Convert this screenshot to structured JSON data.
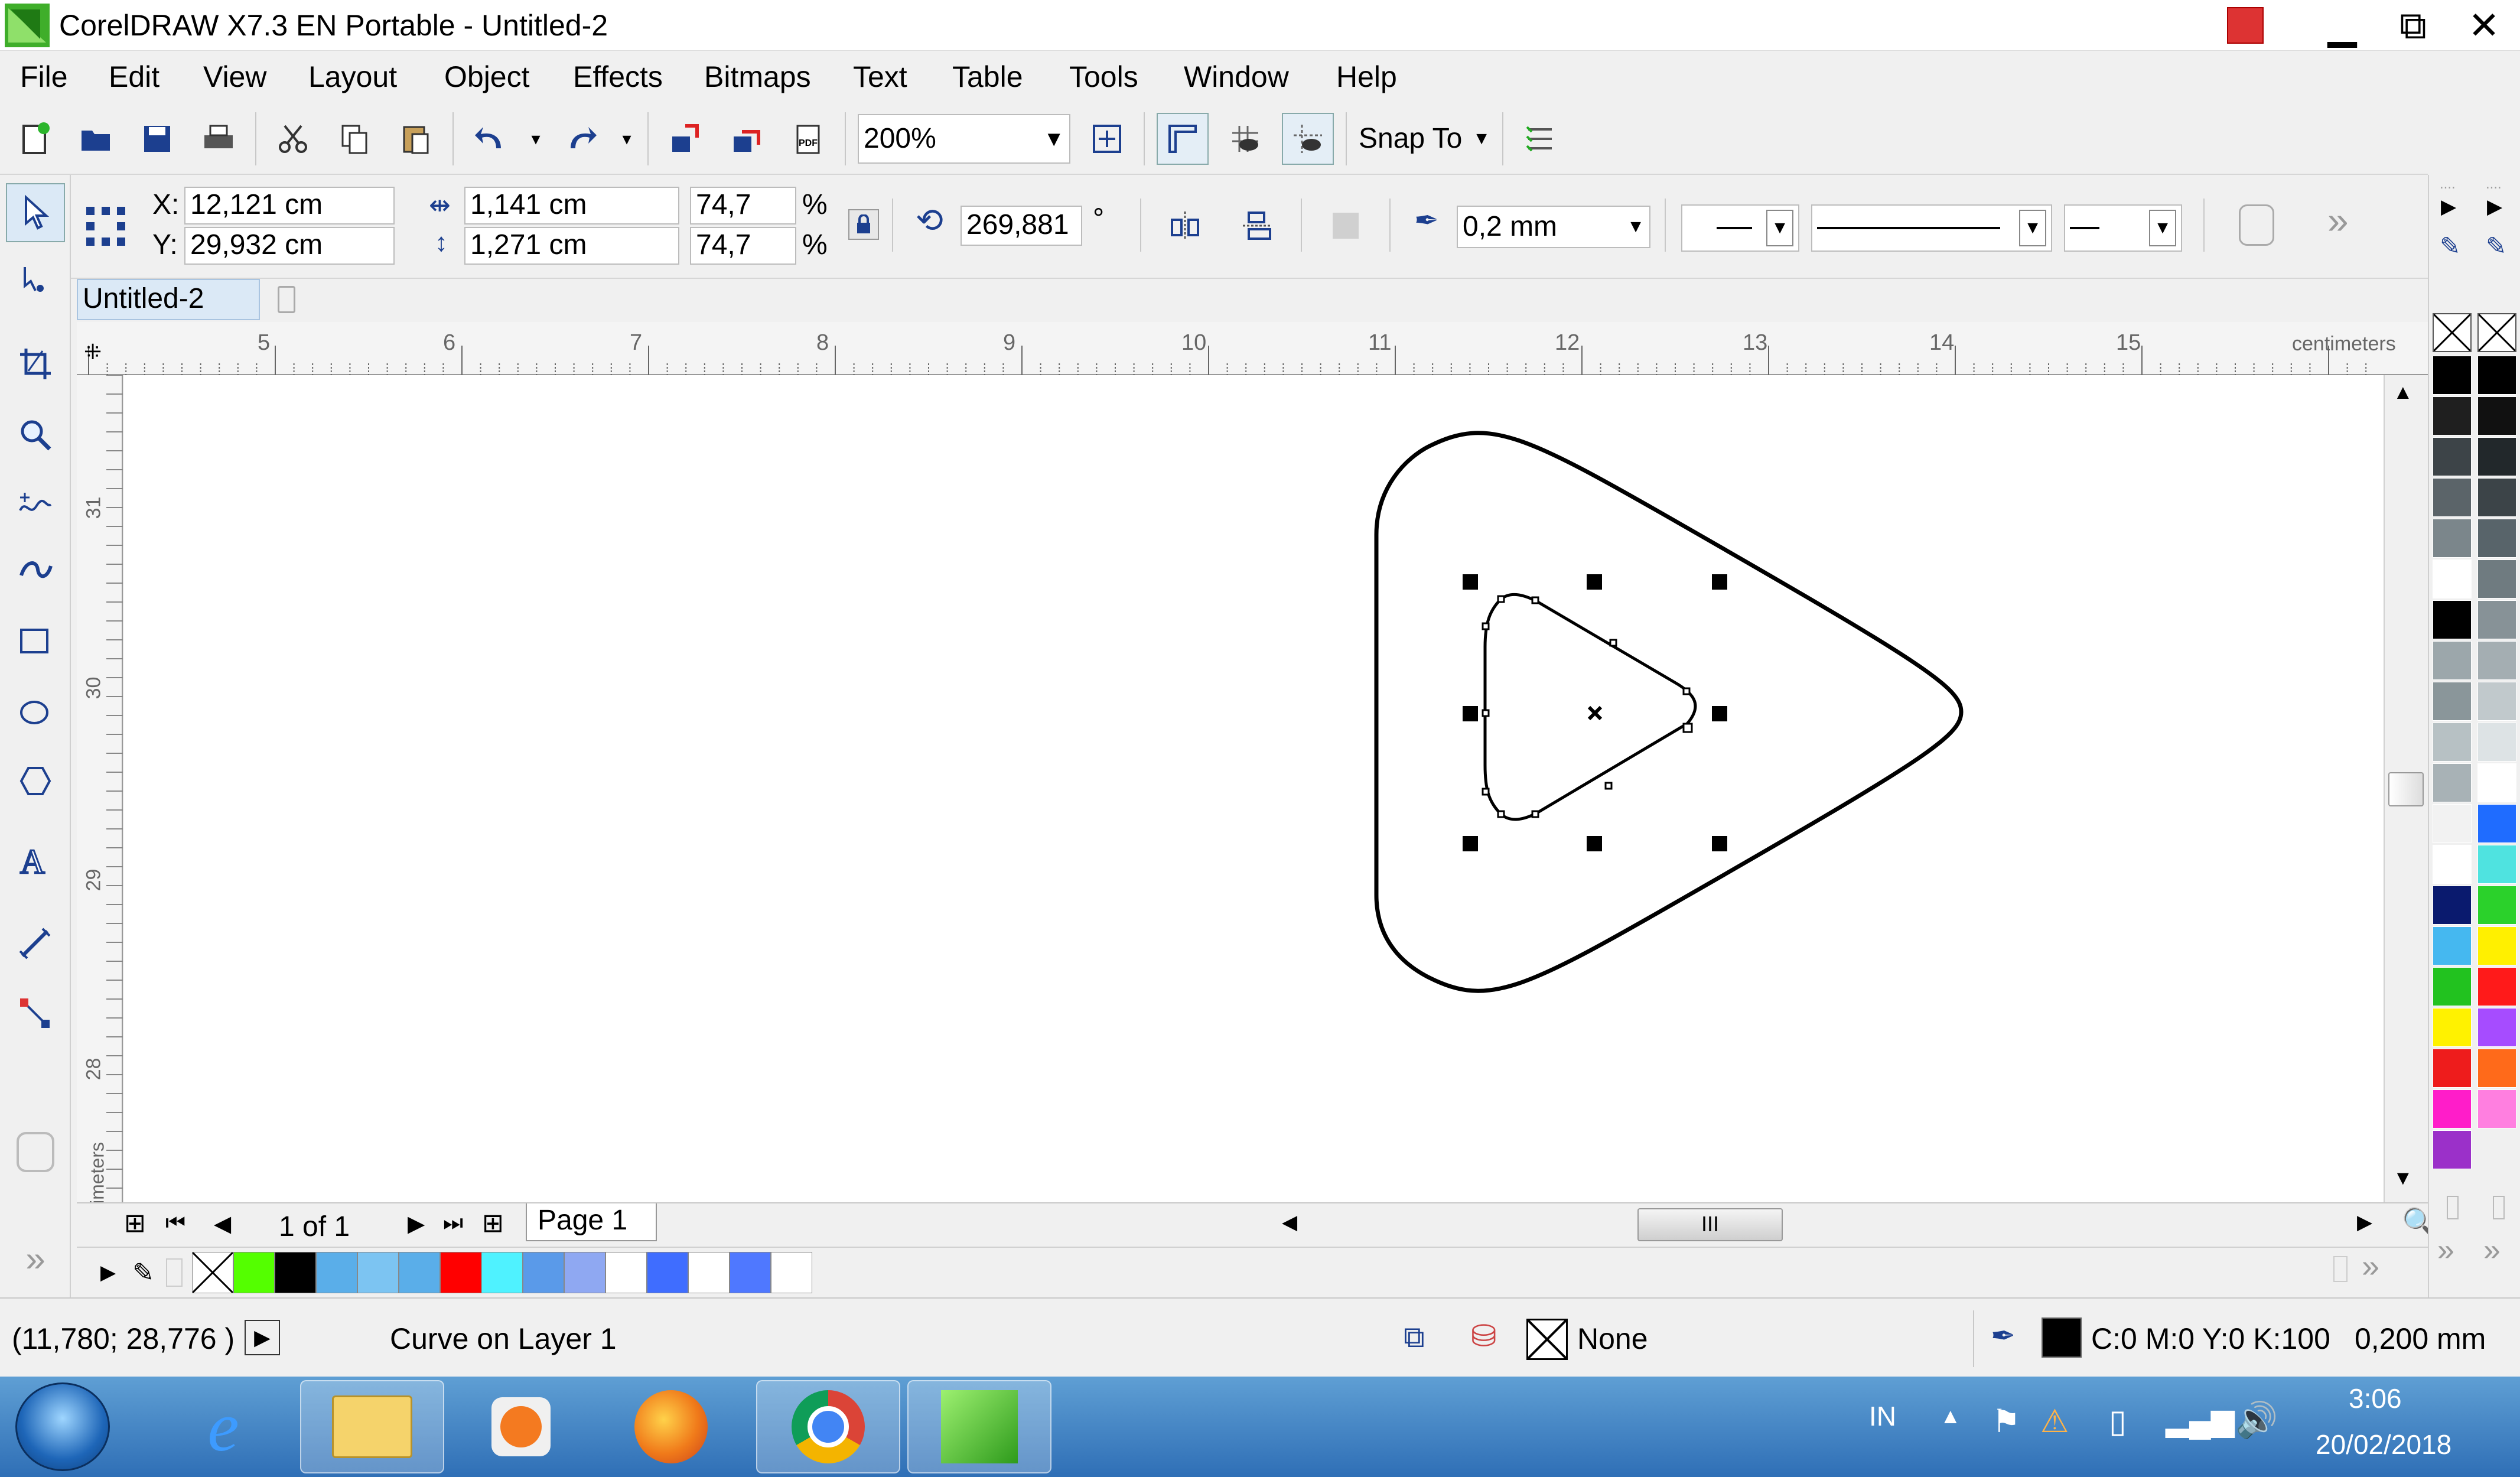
{
  "window": {
    "title": "CorelDRAW X7.3 EN Portable - Untitled-2",
    "controls": {
      "minimize": "▁",
      "restore": "⧉",
      "close": "✕"
    }
  },
  "menu": [
    "File",
    "Edit",
    "View",
    "Layout",
    "Object",
    "Effects",
    "Bitmaps",
    "Text",
    "Table",
    "Tools",
    "Window",
    "Help"
  ],
  "standard_toolbar": {
    "icons": [
      "new-document-icon",
      "open-icon",
      "save-icon",
      "print-icon",
      "cut-icon",
      "copy-icon",
      "paste-icon",
      "undo-icon",
      "redo-icon",
      "import-icon",
      "export-icon",
      "publish-pdf-icon"
    ],
    "zoom": "200%",
    "snap_to": "Snap To"
  },
  "property_bar": {
    "x_label": "X:",
    "x_value": "12,121 cm",
    "y_label": "Y:",
    "y_value": "29,932 cm",
    "width_value": "1,141 cm",
    "height_value": "1,271 cm",
    "scale_w": "74,7",
    "scale_h": "74,7",
    "percent": "%",
    "rotation": "269,881",
    "degree": "°",
    "outline_width": "0,2 mm"
  },
  "document": {
    "tab": "Untitled-2"
  },
  "ruler": {
    "top_ticks": [
      "5",
      "6",
      "7",
      "8",
      "9",
      "10",
      "11",
      "12",
      "13",
      "14",
      "15"
    ],
    "left_ticks": [
      "31",
      "30",
      "29",
      "28"
    ],
    "unit": "centimeters"
  },
  "page_nav": {
    "page_count": "1 of 1",
    "page_tab": "Page 1"
  },
  "status": {
    "coords": "(11,780; 28,776 )",
    "object_info": "Curve on Layer 1",
    "fill": "None",
    "outline_color": "C:0 M:0 Y:0 K:100",
    "outline_width": "0,200 mm"
  },
  "palette_right_col1": [
    "#000000",
    "#1f1f1f",
    "#3d4448",
    "#5b6469",
    "#7b868b",
    "#ffffff",
    "#000000",
    "#9ca7ab",
    "#8a969a",
    "#b7c1c4",
    "#a8b2b6",
    "#f2f2f2",
    "#ffffff",
    "#0a1a6e",
    "#45b8f0",
    "#22c21f",
    "#fff200",
    "#ee1c1c",
    "#ff1dc9",
    "#9b30c9"
  ],
  "palette_right_col2": [
    "#000000",
    "#111111",
    "#22282b",
    "#3c4448",
    "#58646a",
    "#6f7b80",
    "#879297",
    "#a4aeb2",
    "#c1c9cc",
    "#dde3e5",
    "#ffffff",
    "#1f6cff",
    "#4fe3e0",
    "#2bd12b",
    "#fff000",
    "#ff1a1a",
    "#a64cff",
    "#ff6a1a",
    "#ff7fe0"
  ],
  "document_palette": [
    "#54ff00",
    "#000000",
    "#5aaee9",
    "#7cc4f2",
    "#5aaee9",
    "#ff0000",
    "#4ff2ff",
    "#5a9ae9",
    "#8fa8f2",
    "#ffffff",
    "#3f6dff",
    "#ffffff",
    "#4f78ff",
    "#ffffff"
  ],
  "taskbar": {
    "apps": [
      "start-orb",
      "internet-explorer",
      "file-explorer",
      "media-player",
      "firefox",
      "chrome",
      "coreldraw"
    ],
    "language": "IN",
    "time": "3:06",
    "date": "20/02/2018"
  }
}
